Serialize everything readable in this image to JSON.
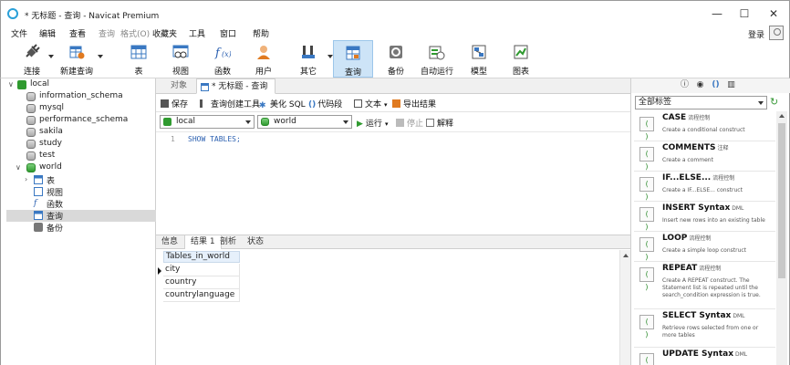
{
  "window": {
    "title": "* 无标题 - 查询 - Navicat Premium",
    "minimize": "—",
    "maximize": "☐",
    "close": "✕"
  },
  "menu": [
    "文件",
    "编辑",
    "查看",
    "查询",
    "格式(O)",
    "收藏夹",
    "工具",
    "窗口",
    "帮助"
  ],
  "login": "登录",
  "toolbar": {
    "connect": "连接",
    "new_query": "新建查询",
    "table": "表",
    "view": "视图",
    "function": "函数",
    "user": "用户",
    "other": "其它",
    "query": "查询",
    "backup": "备份",
    "autorun": "自动运行",
    "model": "模型",
    "chart": "图表"
  },
  "tree": {
    "connection": "local",
    "databases": [
      "information_schema",
      "mysql",
      "performance_schema",
      "sakila",
      "study",
      "test",
      "world"
    ],
    "world_children": [
      "表",
      "视图",
      "函数",
      "查询",
      "备份"
    ]
  },
  "tabs": {
    "objects": "对象",
    "query_tab": "* 无标题 - 查询"
  },
  "query_toolbar": {
    "save": "保存",
    "builder": "查询创建工具",
    "beautify": "美化 SQL",
    "snippet": "代码段",
    "text": "文本",
    "export": "导出结果"
  },
  "controls": {
    "connection": "local",
    "database": "world",
    "run": "运行",
    "stop": "停止",
    "explain": "解释"
  },
  "editor": {
    "line": "1",
    "code": "SHOW TABLES;"
  },
  "result_tabs": [
    "信息",
    "结果 1",
    "剖析",
    "状态"
  ],
  "result": {
    "header": "Tables_in_world",
    "rows": [
      "city",
      "country",
      "countrylanguage"
    ]
  },
  "right_panel": {
    "icons": [
      "ⓘ",
      "◉",
      "()",
      "▥"
    ],
    "tag_filter": "全部标签",
    "snippets": [
      {
        "title": "CASE",
        "tag": "流程控制",
        "desc": "Create a conditional construct"
      },
      {
        "title": "COMMENTS",
        "tag": "注释",
        "desc": "Create a comment"
      },
      {
        "title": "IF...ELSE...",
        "tag": "流程控制",
        "desc": "Create a IF...ELSE... construct"
      },
      {
        "title": "INSERT Syntax",
        "tag": "DML",
        "desc": "Insert new rows into an existing table"
      },
      {
        "title": "LOOP",
        "tag": "流程控制",
        "desc": "Create a simple loop construct"
      },
      {
        "title": "REPEAT",
        "tag": "流程控制",
        "desc": "Create A REPEAT construct. The Statement list is repeated until the search_condition expression is true."
      },
      {
        "title": "SELECT Syntax",
        "tag": "DML",
        "desc": "Retrieve rows selected from one or more tables"
      },
      {
        "title": "UPDATE Syntax",
        "tag": "DML",
        "desc": ""
      }
    ]
  },
  "colors": {
    "accent": "#2aa0d8",
    "active_tool": "#cde4f7",
    "db_green": "#2f9a2f",
    "code_blue": "#2a5fb0"
  }
}
